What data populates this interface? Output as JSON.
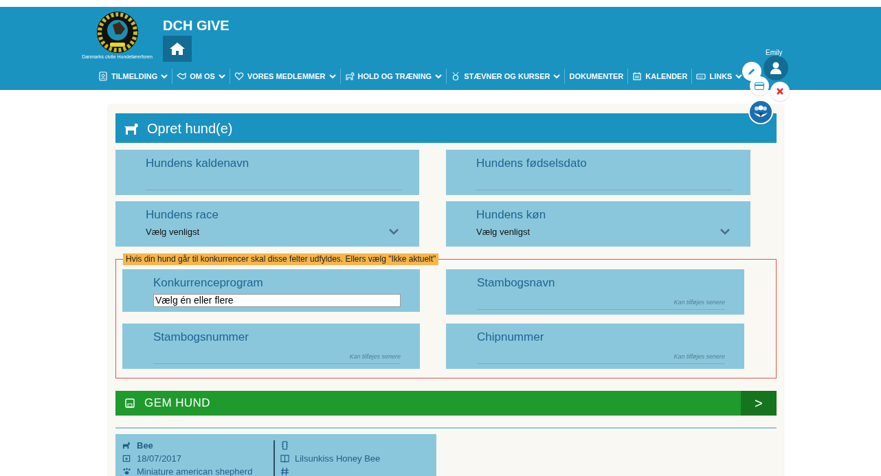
{
  "header": {
    "title": "DCH GIVE",
    "logo_caption": "Danmarks civile Hundeførerforen",
    "user_name": "Emily"
  },
  "nav": [
    {
      "label": "TILMELDING",
      "kind": "contact",
      "dropdown": true
    },
    {
      "label": "OM OS",
      "kind": "handshake",
      "dropdown": true
    },
    {
      "label": "VORES MEDLEMMER",
      "kind": "heart",
      "dropdown": true
    },
    {
      "label": "HOLD OG TRÆNING",
      "kind": "dog",
      "dropdown": true
    },
    {
      "label": "STÆVNER OG KURSER",
      "kind": "medal",
      "dropdown": true
    },
    {
      "label": "DOKUMENTER",
      "kind": "plain",
      "dropdown": false
    },
    {
      "label": "KALENDER",
      "kind": "calendar",
      "dropdown": false
    },
    {
      "label": "LINKS",
      "kind": "keyboard",
      "dropdown": true
    }
  ],
  "form": {
    "title": "Opret hund(e)",
    "fields": [
      {
        "label": "Hundens kaldenavn",
        "kind": "text"
      },
      {
        "label": "Hundens fødselsdato",
        "kind": "text"
      },
      {
        "label": "Hundens race",
        "kind": "select",
        "value": "Vælg venligst"
      },
      {
        "label": "Hundens køn",
        "kind": "select",
        "value": "Vælg venligst"
      }
    ],
    "competition_note": "Hvis din hund går til konkurrencer skal disse felter udfyldes. Ellers vælg \"Ikke aktuelt\"",
    "competition_fields": [
      {
        "label": "Konkurrenceprogram",
        "kind": "multiselect",
        "value": "Vælg én eller flere"
      },
      {
        "label": "Stambogsnavn",
        "kind": "text",
        "placeholder": "Kan tilføjes senere"
      },
      {
        "label": "Stambogsnummer",
        "kind": "text",
        "placeholder": "Kan tilføjes senere"
      },
      {
        "label": "Chipnummer",
        "kind": "text",
        "placeholder": "Kan tilføjes senere"
      }
    ],
    "save_button": "GEM HUND",
    "save_arrow": ">"
  },
  "dog_card": {
    "left": [
      {
        "kind": "dog",
        "text": "Bee",
        "bold": true
      },
      {
        "kind": "calendar",
        "text": "18/07/2017",
        "bold": false
      },
      {
        "kind": "paw",
        "text": "Miniature american shepherd",
        "bold": false
      }
    ],
    "right": [
      {
        "kind": "chip"
      },
      {
        "kind": "book",
        "text": "Lilsunkiss Honey Bee"
      },
      {
        "kind": "hash"
      }
    ]
  }
}
